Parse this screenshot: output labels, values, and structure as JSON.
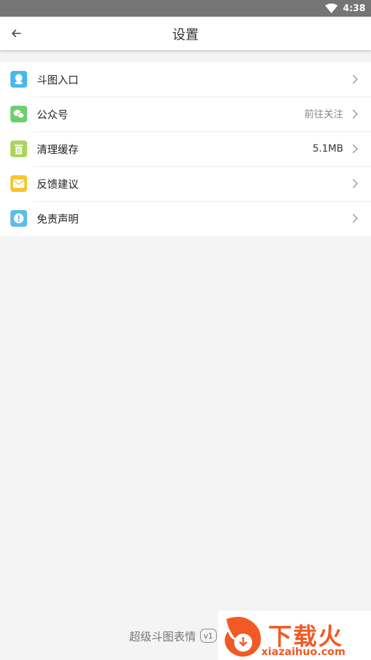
{
  "status_bar": {
    "time": "4:38"
  },
  "header": {
    "title": "设置"
  },
  "settings": {
    "items": [
      {
        "label": "斗图入口",
        "value": "",
        "icon": "qq-penguin-icon",
        "color": "#49b8ec"
      },
      {
        "label": "公众号",
        "value": "前往关注",
        "icon": "wechat-icon",
        "color": "#6dd06e"
      },
      {
        "label": "清理缓存",
        "value": "5.1MB",
        "icon": "trash-icon",
        "color": "#a9d65a"
      },
      {
        "label": "反馈建议",
        "value": "",
        "icon": "mail-icon",
        "color": "#f7c52f"
      },
      {
        "label": "免责声明",
        "value": "",
        "icon": "alert-icon",
        "color": "#5dbde9"
      }
    ]
  },
  "footer": {
    "app_name": "超级斗图表情",
    "version_badge": "v1"
  },
  "watermark": {
    "brand": "下载火",
    "url": "xiazaihuo.com"
  }
}
